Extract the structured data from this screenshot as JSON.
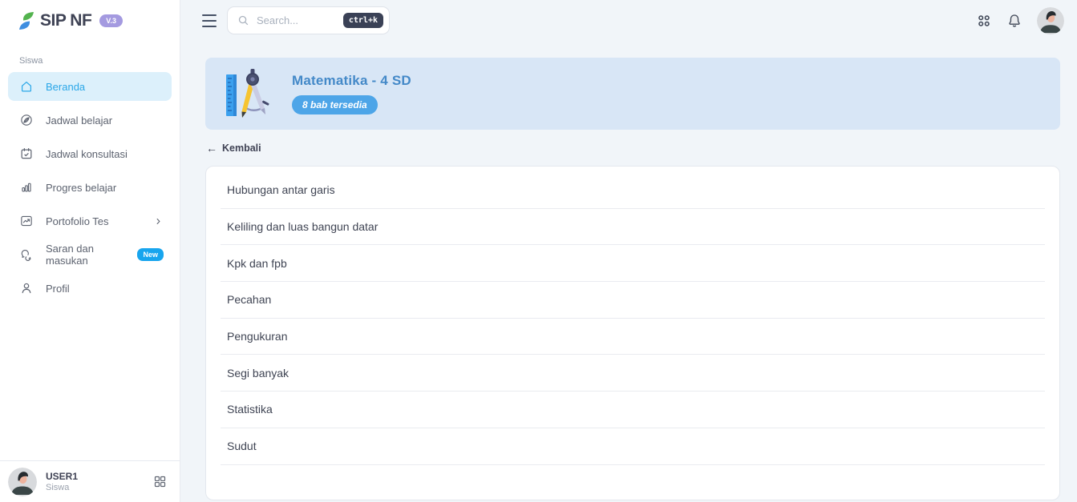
{
  "app": {
    "name": "SIP NF",
    "version_badge": "V.3"
  },
  "topbar": {
    "search_placeholder": "Search...",
    "search_shortcut": "ctrl+k"
  },
  "sidebar": {
    "section_label": "Siswa",
    "items": [
      {
        "label": "Beranda",
        "icon": "home-icon",
        "active": true
      },
      {
        "label": "Jadwal belajar",
        "icon": "leaf-circle-icon"
      },
      {
        "label": "Jadwal konsultasi",
        "icon": "calendar-check-icon"
      },
      {
        "label": "Progres belajar",
        "icon": "bar-chart-icon"
      },
      {
        "label": "Portofolio Tes",
        "icon": "trend-chart-icon",
        "has_chevron": true
      },
      {
        "label": "Saran dan masukan",
        "icon": "chat-bubbles-icon",
        "badge": "New"
      },
      {
        "label": "Profil",
        "icon": "user-icon"
      }
    ],
    "user": {
      "name": "USER1",
      "role": "Siswa"
    }
  },
  "main": {
    "course": {
      "title": "Matematika - 4 SD",
      "badge": "8 bab tersedia"
    },
    "back_arrow": "←",
    "back_label": "Kembali",
    "chapters": [
      "Hubungan antar garis",
      "Keliling dan luas bangun datar",
      "Kpk dan fpb",
      "Pecahan",
      "Pengukuran",
      "Segi banyak",
      "Statistika",
      "Sudut"
    ]
  },
  "colors": {
    "page_bg": "#f1f5f9",
    "accent_blue": "#2ba7e8",
    "active_item_bg": "#dcf0fb",
    "banner_bg": "#d8e6f6",
    "banner_title": "#4489c8",
    "banner_badge_bg": "#4da5e8",
    "new_badge_bg": "#18a5ee",
    "version_badge_bg": "#a49ae0",
    "shortcut_badge_bg": "#3a4156",
    "logo_leaf_green": "#53b34e",
    "logo_leaf_blue": "#3f8ee0"
  }
}
